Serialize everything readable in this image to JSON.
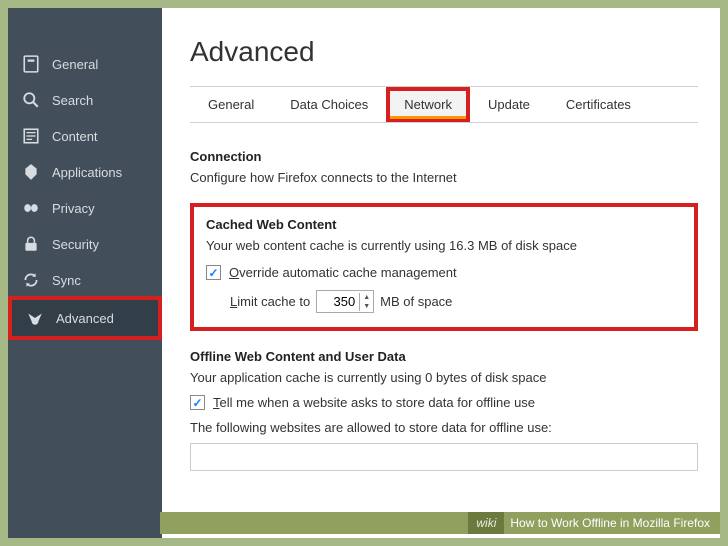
{
  "sidebar": {
    "items": [
      {
        "label": "General"
      },
      {
        "label": "Search"
      },
      {
        "label": "Content"
      },
      {
        "label": "Applications"
      },
      {
        "label": "Privacy"
      },
      {
        "label": "Security"
      },
      {
        "label": "Sync"
      },
      {
        "label": "Advanced"
      }
    ]
  },
  "page": {
    "title": "Advanced"
  },
  "tabs": [
    {
      "label": "General"
    },
    {
      "label": "Data Choices"
    },
    {
      "label": "Network"
    },
    {
      "label": "Update"
    },
    {
      "label": "Certificates"
    }
  ],
  "connection": {
    "title": "Connection",
    "text": "Configure how Firefox connects to the Internet"
  },
  "cached": {
    "title": "Cached Web Content",
    "status": "Your web content cache is currently using 16.3 MB of disk space",
    "override_prefix": "O",
    "override_label": "verride automatic cache management",
    "limit_prefix": "L",
    "limit_label": "imit cache to",
    "limit_value": "350",
    "limit_suffix": "MB of space"
  },
  "offline": {
    "title": "Offline Web Content and User Data",
    "status": "Your application cache is currently using 0 bytes of disk space",
    "tell_prefix": "T",
    "tell_label": "ell me when a website asks to store data for offline use",
    "allowed_label": "The following websites are allowed to store data for offline use:"
  },
  "footer": {
    "wiki": "wiki",
    "text": "How to Work Offline in Mozilla Firefox"
  }
}
